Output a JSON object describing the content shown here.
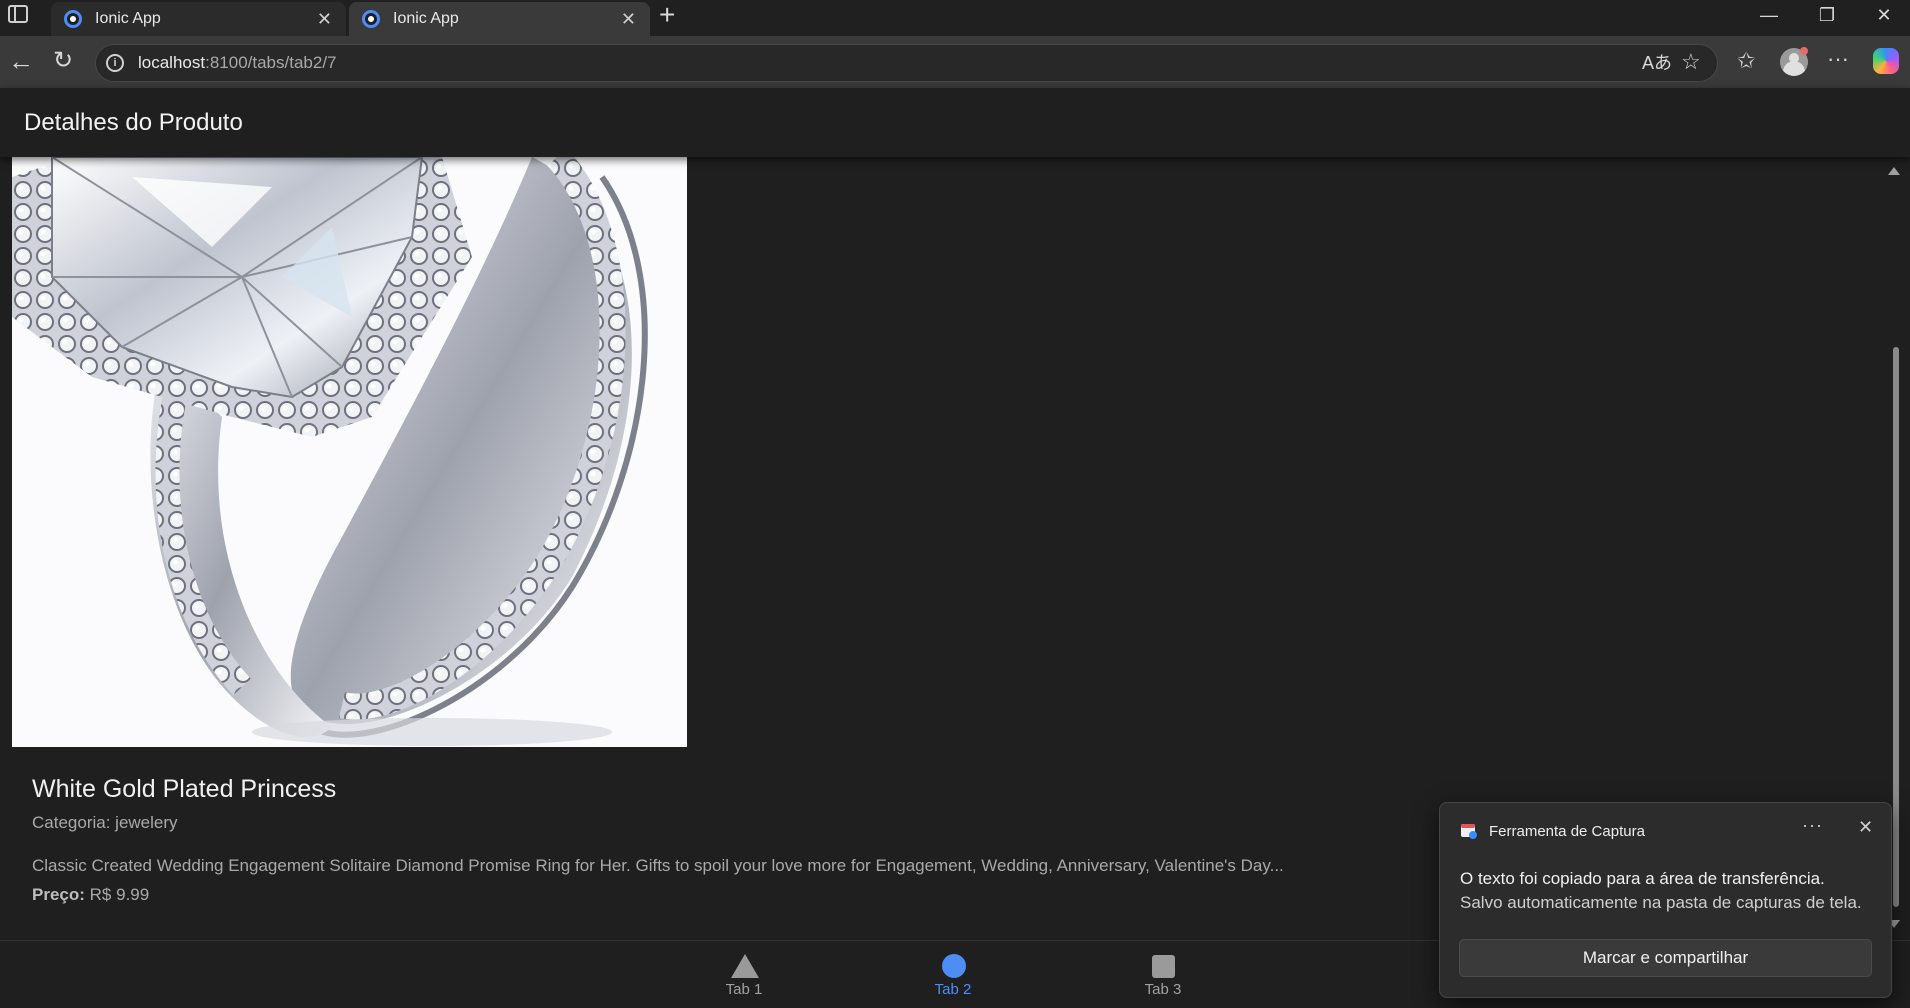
{
  "browser": {
    "tabs": [
      {
        "title": "Ionic App",
        "active": false
      },
      {
        "title": "Ionic App",
        "active": true
      }
    ],
    "url_host": "localhost",
    "url_path": ":8100/tabs/tab2/7",
    "icons": [
      "tab-actions-icon",
      "new-tab-icon",
      "minimize-icon",
      "restore-icon",
      "close-window-icon",
      "back-icon",
      "refresh-icon",
      "site-info-icon",
      "read-aloud-icon",
      "favorite-star-icon",
      "favorites-icon",
      "profile-avatar",
      "more-icon",
      "copilot-icon"
    ]
  },
  "page": {
    "title": "Detalhes do Produto",
    "product": {
      "name": "White Gold Plated Princess",
      "category_label": "Categoria:",
      "category": "jewelery",
      "description": "Classic Created Wedding Engagement Solitaire Diamond Promise Ring for Her. Gifts to spoil your love more for Engagement, Wedding, Anniversary, Valentine's Day...",
      "price_label": "Preço:",
      "price": "R$ 9.99"
    }
  },
  "tabbar": {
    "items": [
      {
        "label": "Tab 1",
        "icon": "triangle-icon",
        "active": false
      },
      {
        "label": "Tab 2",
        "icon": "ellipse-icon",
        "active": true
      },
      {
        "label": "Tab 3",
        "icon": "square-icon",
        "active": false
      }
    ],
    "active_color": "#4d8df6"
  },
  "toast": {
    "app": "Ferramenta de Captura",
    "line1": "O texto foi copiado para a área de transferência.",
    "line2": "Salvo automaticamente na pasta de capturas de tela.",
    "action": "Marcar e compartilhar"
  }
}
